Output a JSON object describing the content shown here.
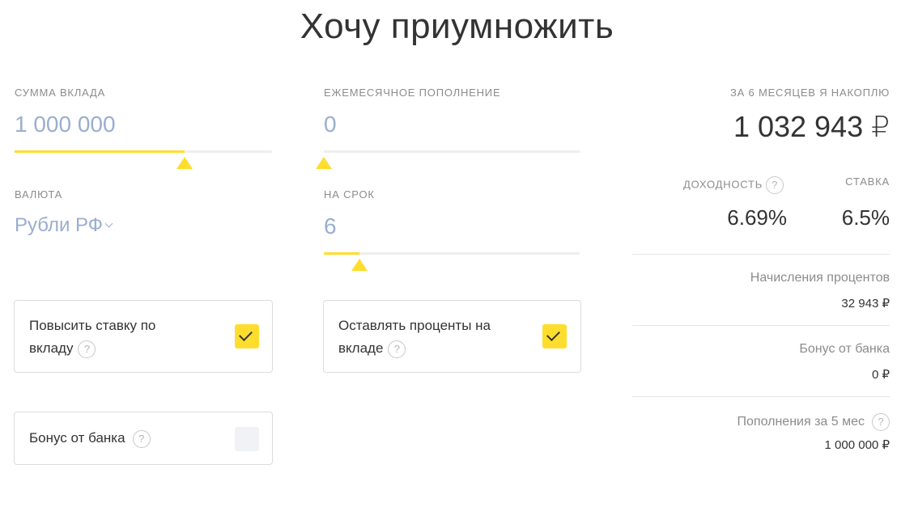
{
  "title": "Хочу приумножить",
  "deposit": {
    "label": "СУММА ВКЛАДА",
    "value": "1 000 000",
    "slider_fraction": 0.66
  },
  "monthly": {
    "label": "ЕЖЕМЕСЯЧНОЕ ПОПОЛНЕНИЕ",
    "value": "0",
    "slider_fraction": 0.0
  },
  "currency": {
    "label": "ВАЛЮТА",
    "value": "Рубли РФ"
  },
  "term": {
    "label": "НА СРОК",
    "value": "6",
    "slider_fraction": 0.14
  },
  "options": {
    "raise_rate": {
      "line1": "Повысить ставку по",
      "line2": "вкладу",
      "checked": true
    },
    "keep_interest": {
      "line1": "Оставлять проценты на",
      "line2": "вкладе",
      "checked": true
    },
    "bank_bonus": {
      "label": "Бонус от банка",
      "checked": false
    }
  },
  "help_glyph": "?",
  "summary": {
    "label": "ЗА 6 МЕСЯЦЕВ Я НАКОПЛЮ",
    "total": "1 032 943 ₽",
    "yield_label": "ДОХОДНОСТЬ",
    "rate_label": "СТАВКА",
    "yield_value": "6.69%",
    "rate_value": "6.5%",
    "interest_label": "Начисления процентов",
    "interest_value": "32 943 ₽",
    "bonus_label": "Бонус от банка",
    "bonus_value": "0 ₽",
    "topups_label": "Пополнения за 5 мес",
    "topups_value": "1 000 000 ₽"
  },
  "colors": {
    "accent": "#ffdd2d",
    "input_text": "#9aaecf",
    "muted": "#8c8c8c"
  }
}
